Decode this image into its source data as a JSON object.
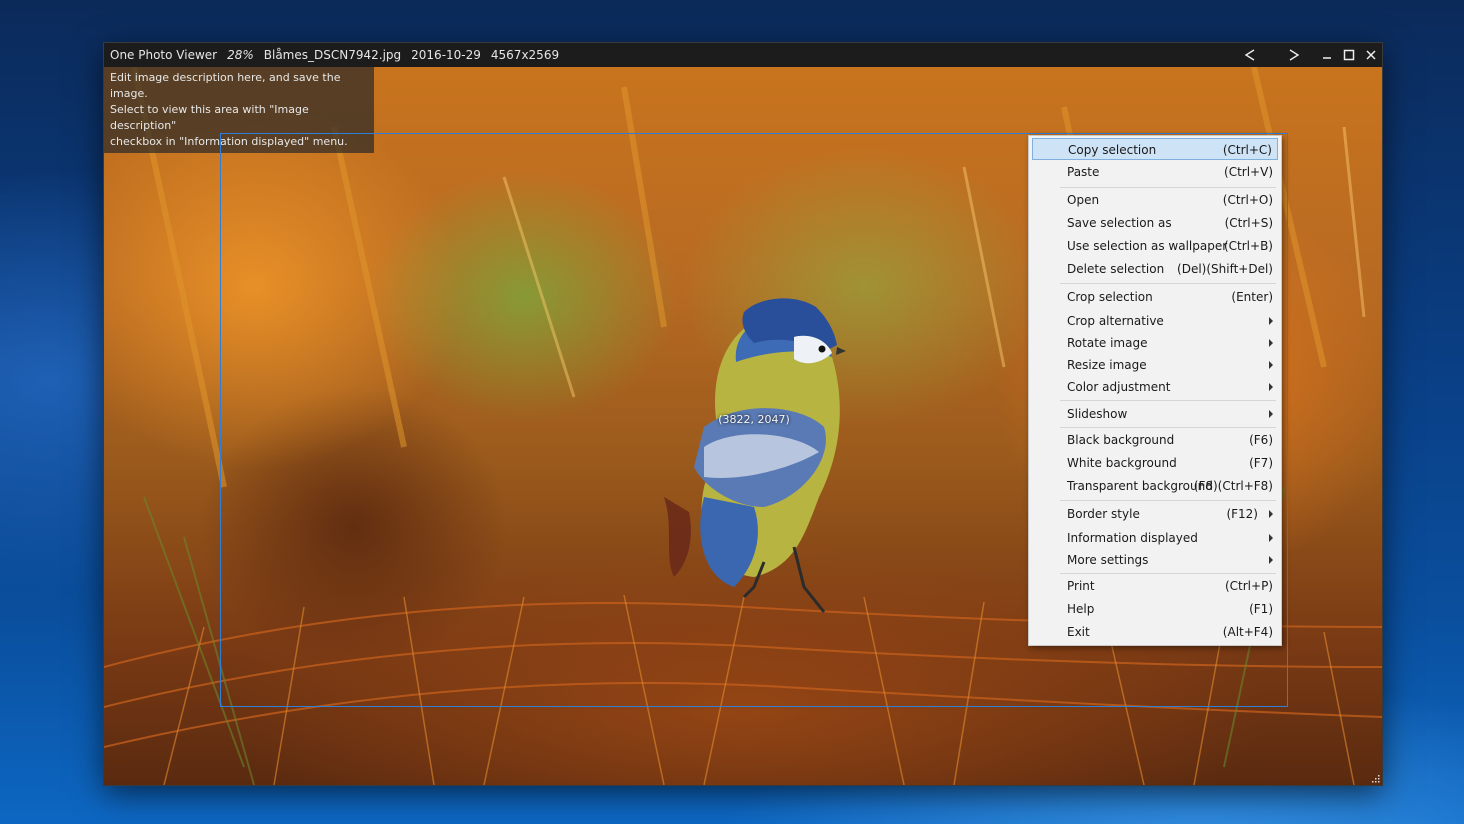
{
  "titlebar": {
    "app_name": "One Photo Viewer",
    "zoom": "28%",
    "filename": "Blåmes_DSCN7942.jpg",
    "date": "2016-10-29",
    "dimensions": "4567x2569",
    "prev_glyph": "<",
    "next_glyph": ">"
  },
  "description_box": {
    "line1": "Edit image description here, and save the image.",
    "line2": "Select to view this area with \"Image description\"",
    "line3": "checkbox in \"Information displayed\" menu."
  },
  "cursor_coordinates": "(3822, 2047)",
  "colors": {
    "selection_border": "#2f7fd8",
    "menu_highlight": "#cfe3f6",
    "titlebar": "#1c1c1c"
  },
  "context_menu": {
    "items": [
      {
        "label": "Copy selection",
        "shortcut": "(Ctrl+C)",
        "submenu": false,
        "highlighted": true
      },
      {
        "label": "Paste",
        "shortcut": "(Ctrl+V)",
        "submenu": false
      },
      {
        "label": "Open",
        "shortcut": "(Ctrl+O)",
        "submenu": false
      },
      {
        "label": "Save selection as",
        "shortcut": "(Ctrl+S)",
        "submenu": false
      },
      {
        "label": "Use selection as wallpaper",
        "shortcut": "(Ctrl+B)",
        "submenu": false
      },
      {
        "label": "Delete selection",
        "shortcut": "(Del)(Shift+Del)",
        "submenu": false
      },
      {
        "label": "Crop selection",
        "shortcut": "(Enter)",
        "submenu": false
      },
      {
        "label": "Crop alternative",
        "shortcut": "",
        "submenu": true
      },
      {
        "label": "Rotate image",
        "shortcut": "",
        "submenu": true
      },
      {
        "label": "Resize image",
        "shortcut": "",
        "submenu": true
      },
      {
        "label": "Color adjustment",
        "shortcut": "",
        "submenu": true
      },
      {
        "label": "Slideshow",
        "shortcut": "",
        "submenu": true
      },
      {
        "label": "Black background",
        "shortcut": "(F6)",
        "submenu": false
      },
      {
        "label": "White background",
        "shortcut": "(F7)",
        "submenu": false
      },
      {
        "label": "Transparent background",
        "shortcut": "(F8)(Ctrl+F8)",
        "submenu": false
      },
      {
        "label": "Border style",
        "shortcut": "(F12)",
        "submenu": true
      },
      {
        "label": "Information displayed",
        "shortcut": "",
        "submenu": true
      },
      {
        "label": "More settings",
        "shortcut": "",
        "submenu": true
      },
      {
        "label": "Print",
        "shortcut": "(Ctrl+P)",
        "submenu": false
      },
      {
        "label": "Help",
        "shortcut": "(F1)",
        "submenu": false
      },
      {
        "label": "Exit",
        "shortcut": "(Alt+F4)",
        "submenu": false
      }
    ]
  }
}
